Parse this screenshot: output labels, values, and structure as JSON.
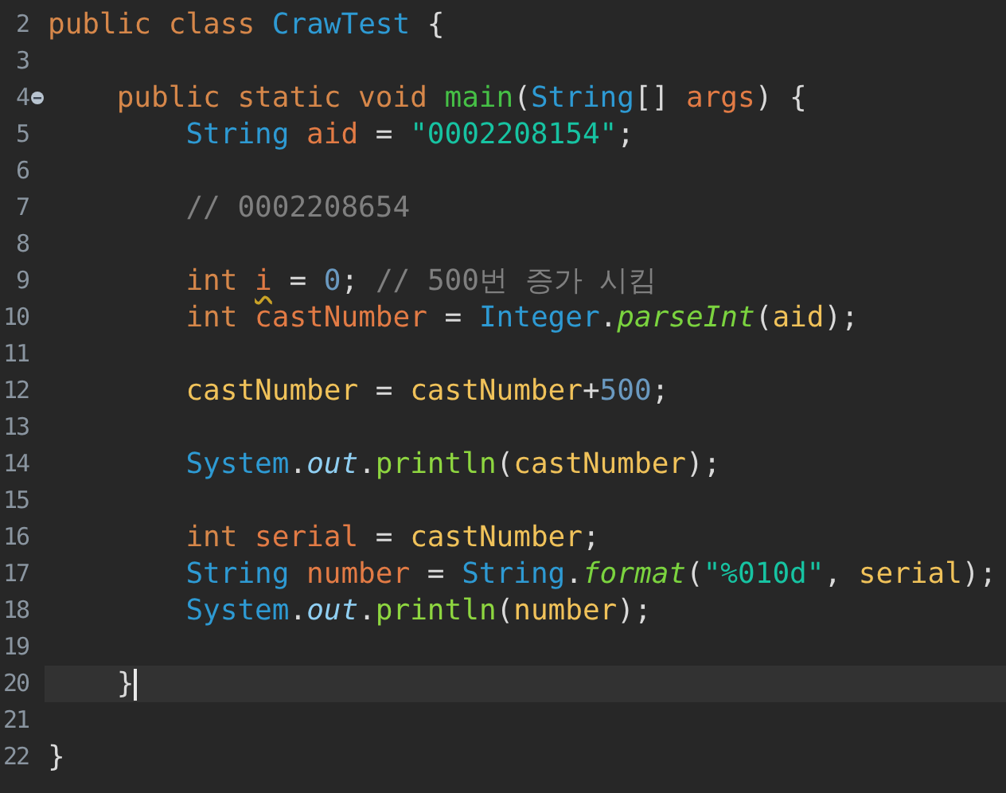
{
  "editor": {
    "lines": [
      {
        "number": "2",
        "current": false,
        "tokens": [
          {
            "text": "public class ",
            "kind": "keyword"
          },
          {
            "text": "CrawTest",
            "kind": "type"
          },
          {
            "text": " {",
            "kind": "plain"
          }
        ],
        "children": [
          {
            "number": "3",
            "current": false
          },
          {
            "number": "4",
            "current": false,
            "collapsible": true,
            "tokens": [
              {
                "text": "public static void ",
                "kind": "keyword"
              },
              {
                "text": "main",
                "kind": "method-decl"
              },
              {
                "text": "(",
                "kind": "plain"
              },
              {
                "text": "String",
                "kind": "type"
              },
              {
                "text": "[] ",
                "kind": "plain"
              },
              {
                "text": "args",
                "kind": "local"
              },
              {
                "text": ") {",
                "kind": "plain"
              }
            ],
            "children": [
              {
                "number": "5",
                "current": false,
                "tokens": [
                  {
                    "text": "String ",
                    "kind": "type"
                  },
                  {
                    "text": "aid",
                    "kind": "local"
                  },
                  {
                    "text": " = ",
                    "kind": "plain"
                  },
                  {
                    "text": "\"0002208154\"",
                    "kind": "string"
                  },
                  {
                    "text": ";",
                    "kind": "plain"
                  }
                ]
              },
              {
                "number": "6",
                "current": false
              },
              {
                "number": "7",
                "current": false,
                "tokens": [
                  {
                    "text": "// 0002208654",
                    "kind": "comment"
                  }
                ]
              },
              {
                "number": "8",
                "current": false
              },
              {
                "number": "9",
                "current": false,
                "tokens": [
                  {
                    "text": "int ",
                    "kind": "keyword"
                  },
                  {
                    "text": "i",
                    "kind": "local-warning"
                  },
                  {
                    "text": " = ",
                    "kind": "plain"
                  },
                  {
                    "text": "0",
                    "kind": "number"
                  },
                  {
                    "text": "; ",
                    "kind": "plain"
                  },
                  {
                    "text": "// 500번 증가 시킴",
                    "kind": "comment"
                  }
                ]
              },
              {
                "number": "10",
                "current": false,
                "tokens": [
                  {
                    "text": "int ",
                    "kind": "keyword"
                  },
                  {
                    "text": "castNumber",
                    "kind": "local"
                  },
                  {
                    "text": " = ",
                    "kind": "plain"
                  },
                  {
                    "text": "Integer",
                    "kind": "type"
                  },
                  {
                    "text": ".",
                    "kind": "plain"
                  },
                  {
                    "text": "parseInt",
                    "kind": "static-method"
                  },
                  {
                    "text": "(",
                    "kind": "plain"
                  },
                  {
                    "text": "aid",
                    "kind": "var"
                  },
                  {
                    "text": ");",
                    "kind": "plain"
                  }
                ]
              },
              {
                "number": "11",
                "current": false
              },
              {
                "number": "12",
                "current": false,
                "tokens": [
                  {
                    "text": "castNumber",
                    "kind": "var"
                  },
                  {
                    "text": " = ",
                    "kind": "plain"
                  },
                  {
                    "text": "castNumber",
                    "kind": "var"
                  },
                  {
                    "text": "+",
                    "kind": "plain"
                  },
                  {
                    "text": "500",
                    "kind": "number"
                  },
                  {
                    "text": ";",
                    "kind": "plain"
                  }
                ]
              },
              {
                "number": "13",
                "current": false
              },
              {
                "number": "14",
                "current": false,
                "tokens": [
                  {
                    "text": "System",
                    "kind": "type"
                  },
                  {
                    "text": ".",
                    "kind": "plain"
                  },
                  {
                    "text": "out",
                    "kind": "static-field"
                  },
                  {
                    "text": ".",
                    "kind": "plain"
                  },
                  {
                    "text": "println",
                    "kind": "method"
                  },
                  {
                    "text": "(",
                    "kind": "plain"
                  },
                  {
                    "text": "castNumber",
                    "kind": "var"
                  },
                  {
                    "text": ");",
                    "kind": "plain"
                  }
                ]
              },
              {
                "number": "15",
                "current": false
              },
              {
                "number": "16",
                "current": false,
                "tokens": [
                  {
                    "text": "int ",
                    "kind": "keyword"
                  },
                  {
                    "text": "serial",
                    "kind": "local"
                  },
                  {
                    "text": " = ",
                    "kind": "plain"
                  },
                  {
                    "text": "castNumber",
                    "kind": "var"
                  },
                  {
                    "text": ";",
                    "kind": "plain"
                  }
                ]
              },
              {
                "number": "17",
                "current": false,
                "tokens": [
                  {
                    "text": "String ",
                    "kind": "type"
                  },
                  {
                    "text": "number",
                    "kind": "local"
                  },
                  {
                    "text": " = ",
                    "kind": "plain"
                  },
                  {
                    "text": "String",
                    "kind": "type"
                  },
                  {
                    "text": ".",
                    "kind": "plain"
                  },
                  {
                    "text": "format",
                    "kind": "static-method"
                  },
                  {
                    "text": "(",
                    "kind": "plain"
                  },
                  {
                    "text": "\"%010d\"",
                    "kind": "string"
                  },
                  {
                    "text": ", ",
                    "kind": "plain"
                  },
                  {
                    "text": "serial",
                    "kind": "var"
                  },
                  {
                    "text": ");",
                    "kind": "plain"
                  }
                ]
              },
              {
                "number": "18",
                "current": false,
                "tokens": [
                  {
                    "text": "System",
                    "kind": "type"
                  },
                  {
                    "text": ".",
                    "kind": "plain"
                  },
                  {
                    "text": "out",
                    "kind": "static-field"
                  },
                  {
                    "text": ".",
                    "kind": "plain"
                  },
                  {
                    "text": "println",
                    "kind": "method"
                  },
                  {
                    "text": "(",
                    "kind": "plain"
                  },
                  {
                    "text": "number",
                    "kind": "var"
                  },
                  {
                    "text": ");",
                    "kind": "plain"
                  }
                ]
              },
              {
                "number": "19",
                "current": false
              }
            ]
          },
          {
            "number": "20",
            "current": true,
            "tokens": [
              {
                "text": "}",
                "kind": "plain"
              }
            ]
          },
          {
            "number": "21",
            "current": false
          }
        ]
      },
      {
        "number": "22",
        "current": false,
        "tokens": [
          {
            "text": "}",
            "kind": "plain"
          }
        ]
      }
    ]
  }
}
